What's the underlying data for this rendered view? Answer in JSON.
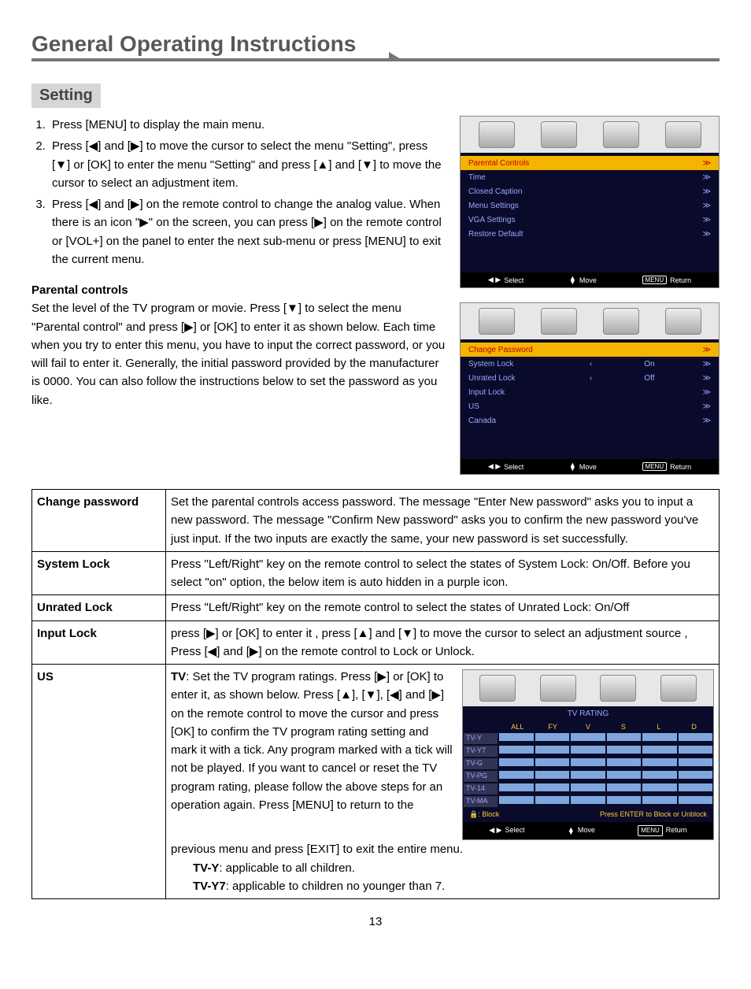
{
  "page": {
    "title": "General Operating Instructions",
    "section": "Setting",
    "number": "13"
  },
  "steps": {
    "s1": "Press [MENU] to display the main menu.",
    "s2": "Press [◀] and [▶] to move the cursor to select the menu \"Setting\", press [▼] or [OK] to enter the menu \"Setting\" and press [▲] and [▼] to move the cursor to select an adjustment item.",
    "s3": "Press [◀] and [▶] on the remote control to change the analog value. When there is an icon \"▶\" on the screen, you can press [▶] on the remote control or [VOL+] on the panel to enter the next sub-menu or press [MENU] to exit the current menu."
  },
  "parental": {
    "heading": "Parental controls",
    "body": "Set the level of the TV program or movie. Press [▼] to select the menu \"Parental control\" and press [▶] or [OK] to enter it as shown below. Each time when you try to enter this menu, you have to input the correct password, or you will fail to enter it. Generally, the initial password provided by the manufacturer is 0000. You can also follow the instructions below to set the password as you like."
  },
  "osd1": {
    "items": [
      "Parental Controls",
      "Time",
      "Closed Caption",
      "Menu Settings",
      "VGA Settings",
      "Restore Default"
    ]
  },
  "osd2": {
    "rows": [
      {
        "label": "Change Password",
        "val": "",
        "hl": true
      },
      {
        "label": "System Lock",
        "val": "On"
      },
      {
        "label": "Unrated Lock",
        "val": "Off"
      },
      {
        "label": "Input Lock",
        "val": ""
      },
      {
        "label": "US",
        "val": ""
      },
      {
        "label": "Canada",
        "val": ""
      }
    ]
  },
  "footer": {
    "select": "Select",
    "move": "Move",
    "menu": "MENU",
    "return": "Return"
  },
  "table": {
    "changepw": {
      "key": "Change password",
      "val": "Set the parental controls access password. The message \"Enter New password\" asks you to input a new password. The message \"Confirm New password\" asks you to confirm the new password you've just input. If the two inputs are exactly the same, your new password is set successfully."
    },
    "syslock": {
      "key": "System Lock",
      "val": "Press \"Left/Right\" key on the remote control to select the states of System Lock: On/Off. Before you select \"on\" option, the below item is auto hidden in a purple icon."
    },
    "unrated": {
      "key": "Unrated Lock",
      "val": "Press \"Left/Right\" key on the remote control to select the states of Unrated Lock: On/Off"
    },
    "inputlock": {
      "key": "Input Lock",
      "val": "press [▶] or [OK] to enter it , press [▲] and [▼] to move the cursor to select an adjustment source , Press [◀] and [▶] on the remote control to Lock or Unlock."
    },
    "us": {
      "key": "US",
      "tvlabel": "TV",
      "tvtext": ": Set the TV program ratings. Press [▶] or [OK] to enter it, as shown below. Press [▲], [▼], [◀] and [▶] on the remote control to move the cursor and press [OK] to confirm the TV program rating setting and mark it with a tick. Any program marked with a tick will not be played. If you want to cancel or reset the TV program rating, please follow the above steps for an operation again. Press [MENU] to return to the",
      "tvtail": "previous menu and press [EXIT] to exit the entire menu.",
      "tvy": {
        "label": "TV-Y",
        "text": ": applicable to all children."
      },
      "tvy7": {
        "label": "TV-Y7",
        "text": ": applicable to children no younger than 7."
      }
    }
  },
  "rating": {
    "title": "TV RATING",
    "cols": [
      "",
      "ALL",
      "FY",
      "V",
      "S",
      "L",
      "D"
    ],
    "rows": [
      "TV-Y",
      "TV-Y7",
      "TV-G",
      "TV-PG",
      "TV-14",
      "TV-MA"
    ],
    "block": ": Block",
    "hint": "Press ENTER to Block or Unblock"
  }
}
